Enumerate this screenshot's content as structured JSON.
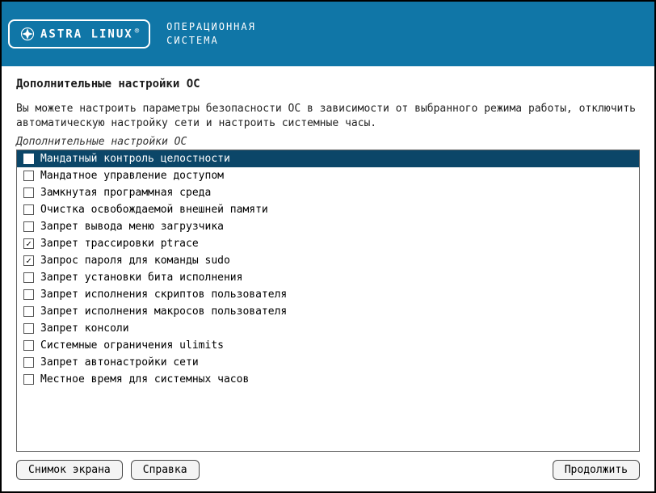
{
  "header": {
    "logo_name": "ASTRA LINUX",
    "os_line1": "ОПЕРАЦИОННАЯ",
    "os_line2": "СИСТЕМА"
  },
  "page": {
    "title": "Дополнительные настройки ОС",
    "description": "Вы можете настроить параметры безопасности ОС в зависимости от выбранного режима работы, отключить автоматическую настройку сети и настроить системные часы.",
    "group_label": "Дополнительные настройки ОС"
  },
  "options": [
    {
      "label": "Мандатный контроль целостности",
      "checked": false,
      "selected": true
    },
    {
      "label": "Мандатное управление доступом",
      "checked": false,
      "selected": false
    },
    {
      "label": "Замкнутая программная среда",
      "checked": false,
      "selected": false
    },
    {
      "label": "Очистка освобождаемой внешней памяти",
      "checked": false,
      "selected": false
    },
    {
      "label": "Запрет вывода меню загрузчика",
      "checked": false,
      "selected": false
    },
    {
      "label": "Запрет трассировки ptrace",
      "checked": true,
      "selected": false
    },
    {
      "label": "Запрос пароля для команды sudo",
      "checked": true,
      "selected": false
    },
    {
      "label": "Запрет установки бита исполнения",
      "checked": false,
      "selected": false
    },
    {
      "label": "Запрет исполнения скриптов пользователя",
      "checked": false,
      "selected": false
    },
    {
      "label": "Запрет исполнения макросов пользователя",
      "checked": false,
      "selected": false
    },
    {
      "label": "Запрет консоли",
      "checked": false,
      "selected": false
    },
    {
      "label": "Системные ограничения ulimits",
      "checked": false,
      "selected": false
    },
    {
      "label": "Запрет автонастройки сети",
      "checked": false,
      "selected": false
    },
    {
      "label": "Местное время для системных часов",
      "checked": false,
      "selected": false
    }
  ],
  "footer": {
    "screenshot": "Снимок экрана",
    "help": "Справка",
    "continue": "Продолжить"
  }
}
